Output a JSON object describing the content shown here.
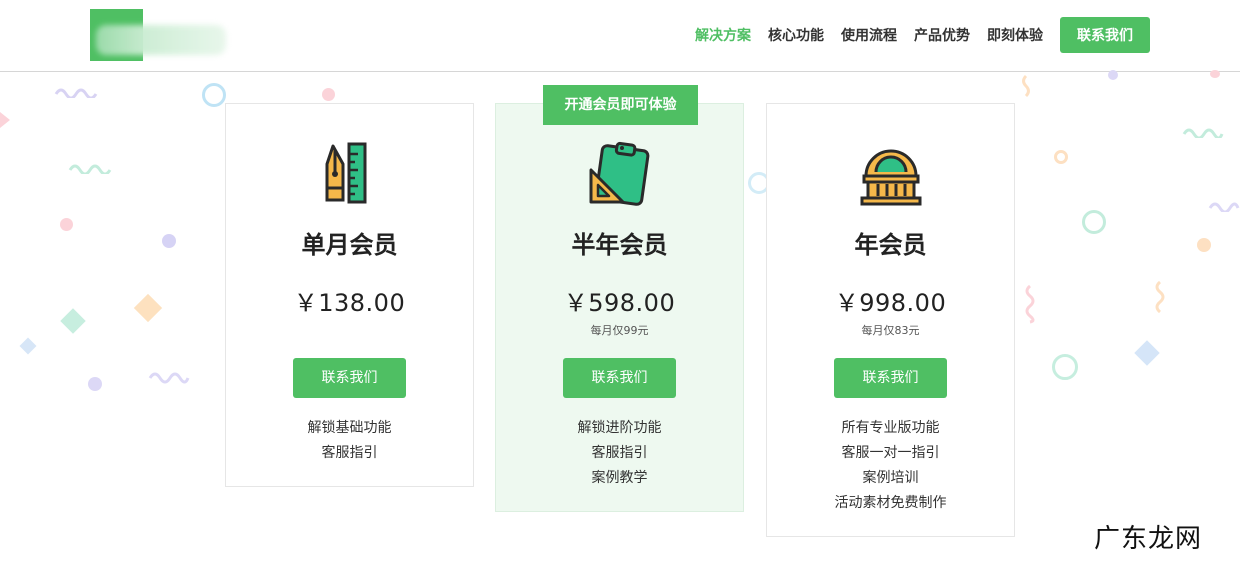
{
  "header": {
    "nav": [
      {
        "label": "解决方案",
        "active": true
      },
      {
        "label": "核心功能",
        "active": false
      },
      {
        "label": "使用流程",
        "active": false
      },
      {
        "label": "产品优势",
        "active": false
      },
      {
        "label": "即刻体验",
        "active": false
      }
    ],
    "contact_label": "联系我们"
  },
  "plans": [
    {
      "name": "单月会员",
      "price": "￥138.00",
      "per_month": "",
      "button": "联系我们",
      "features": [
        "解锁基础功能",
        "客服指引"
      ],
      "icon": "pen-ruler-icon"
    },
    {
      "badge": "开通会员即可体验",
      "name": "半年会员",
      "price": "￥598.00",
      "per_month": "每月仅99元",
      "button": "联系我们",
      "features": [
        "解锁进阶功能",
        "客服指引",
        "案例教学"
      ],
      "icon": "clipboard-set-square-icon"
    },
    {
      "name": "年会员",
      "price": "￥998.00",
      "per_month": "每月仅83元",
      "button": "联系我们",
      "features": [
        "所有专业版功能",
        "客服一对一指引",
        "案例培训",
        "活动素材免费制作"
      ],
      "icon": "building-icon"
    }
  ],
  "watermark": "广东龙网",
  "colors": {
    "accent": "#4fbf63",
    "featured_bg": "#eef9f0",
    "icon_yellow": "#f5b84a",
    "icon_green": "#2fbf86",
    "icon_outline": "#2a2a2a"
  }
}
